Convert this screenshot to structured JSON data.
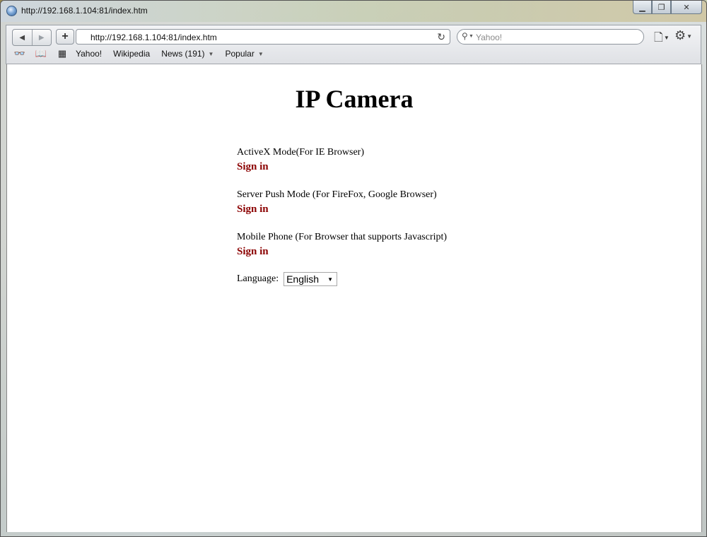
{
  "window": {
    "title": "http://192.168.1.104:81/index.htm",
    "controls": {
      "minimize": "▁",
      "maximize": "❐",
      "close": "✕"
    }
  },
  "toolbar": {
    "back_icon": "◀",
    "forward_icon": "▶",
    "new_tab_icon": "+",
    "address": "http://192.168.1.104:81/index.htm",
    "reload_icon": "↻",
    "search_placeholder": "Yahoo!",
    "search_icon": "⚲",
    "page_menu_icon": "🗋",
    "gear_menu_icon": "⚙"
  },
  "bookmarks": {
    "reading_list_icon": "👓",
    "bookmarks_icon": "📖",
    "top_sites_icon": "▦",
    "items": [
      {
        "label": "Yahoo!",
        "has_menu": false
      },
      {
        "label": "Wikipedia",
        "has_menu": false
      },
      {
        "label": "News (191)",
        "has_menu": true
      },
      {
        "label": "Popular",
        "has_menu": true
      }
    ]
  },
  "page": {
    "title": "IP Camera",
    "modes": [
      {
        "description": "ActiveX Mode(For IE Browser)",
        "link": "Sign in"
      },
      {
        "description": "Server Push Mode (For FireFox, Google Browser)",
        "link": "Sign in"
      },
      {
        "description": "Mobile Phone (For Browser that supports Javascript)",
        "link": "Sign in"
      }
    ],
    "language_label": "Language:",
    "language_value": "English"
  },
  "colors": {
    "link": "#8b0000",
    "content_bg": "#ffffff"
  }
}
